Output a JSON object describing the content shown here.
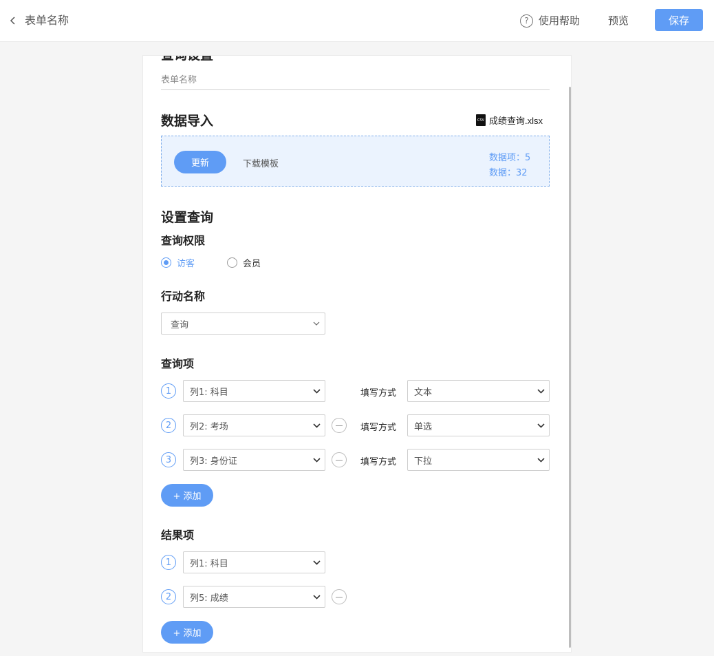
{
  "header": {
    "back_label": "表单名称",
    "help_label": "使用帮助",
    "preview_label": "预览",
    "save_label": "保存"
  },
  "form": {
    "cut_title": "查询设置",
    "name_placeholder": "表单名称"
  },
  "import": {
    "title": "数据导入",
    "file_name": "成绩查询.xlsx",
    "file_icon_text": "CSV",
    "update_label": "更新",
    "download_label": "下载模板",
    "data_items": "数据项：5",
    "data_count": "数据：32"
  },
  "query": {
    "title": "设置查询",
    "permission_title": "查询权限",
    "permission_options": [
      "访客",
      "会员"
    ],
    "permission_selected": "访客",
    "action_title": "行动名称",
    "action_value": "查询",
    "items_title": "查询项",
    "fill_label": "填写方式",
    "items": [
      {
        "index": "1",
        "column": "列1: 科目",
        "fill": "文本"
      },
      {
        "index": "2",
        "column": "列2: 考场",
        "fill": "单选"
      },
      {
        "index": "3",
        "column": "列3: 身份证",
        "fill": "下拉"
      }
    ],
    "add_label": "+ 添加"
  },
  "result": {
    "title": "结果项",
    "items": [
      {
        "index": "1",
        "column": "列1: 科目"
      },
      {
        "index": "2",
        "column": "列5: 成绩"
      }
    ],
    "add_label": "+ 添加"
  },
  "colors": {
    "accent": "#5f9cf5",
    "import_bg": "#ebf3fe"
  }
}
